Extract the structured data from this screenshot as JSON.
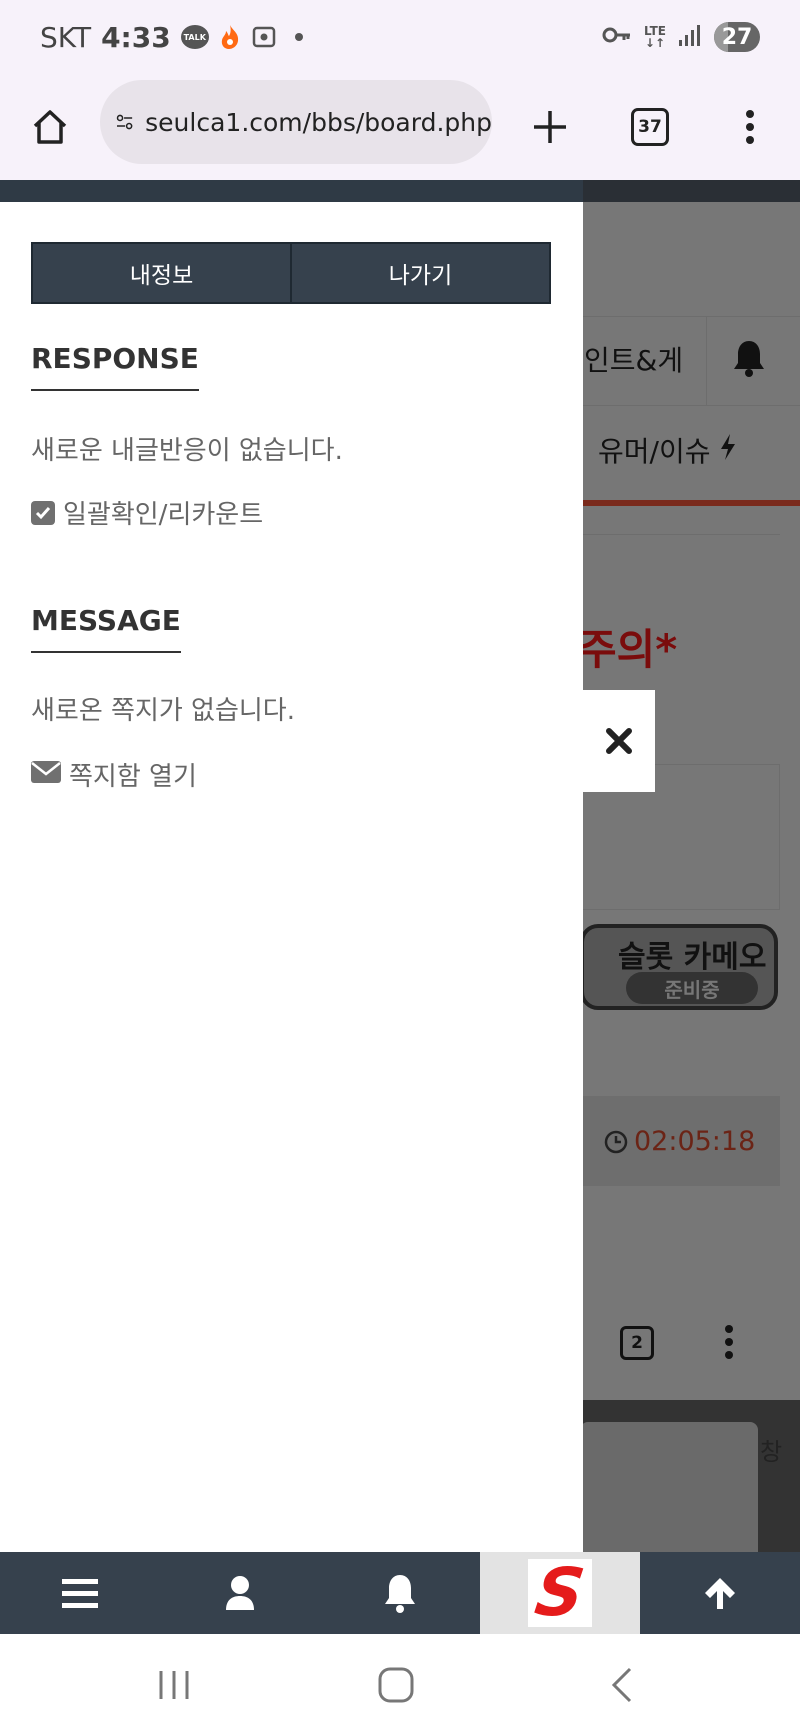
{
  "status_bar": {
    "carrier": "SKT",
    "time": "4:33",
    "talk_badge": "TALK",
    "network": "LTE",
    "battery": "27",
    "icons": [
      "kakaotalk-icon",
      "flame-icon",
      "screenshot-icon",
      "dot-icon",
      "key-icon",
      "lte-icon",
      "signal-icon",
      "battery-icon"
    ]
  },
  "browser": {
    "url": "seulca1.com/bbs/board.php",
    "tab_count": "37"
  },
  "drawer": {
    "buttons": {
      "my_info": "내정보",
      "logout": "나가기"
    },
    "response": {
      "title": "RESPONSE",
      "empty_text": "새로운 내글반응이 없습니다.",
      "recount_link": "일괄확인/리카운트"
    },
    "message": {
      "title": "MESSAGE",
      "empty_text": "새로온 쪽지가 없습니다.",
      "open_link": "쪽지함 열기"
    }
  },
  "background_page": {
    "nav_item_1": "인트&게",
    "nav_item_2": "유머/이슈",
    "warning_text": "주의*",
    "banner_title": "슬롯 카메오",
    "banner_status": "준비중",
    "timer": "02:05:18",
    "inner_tab_count": "2",
    "card_text": "창"
  },
  "bottom_nav": {
    "items": [
      "menu-icon",
      "user-icon",
      "bell-icon",
      "site-logo",
      "arrow-up-icon"
    ],
    "logo_letter": "S"
  },
  "colors": {
    "dark_slate": "#36414d",
    "accent_red": "#e51b1b",
    "browser_bg": "#f7f2fa"
  }
}
